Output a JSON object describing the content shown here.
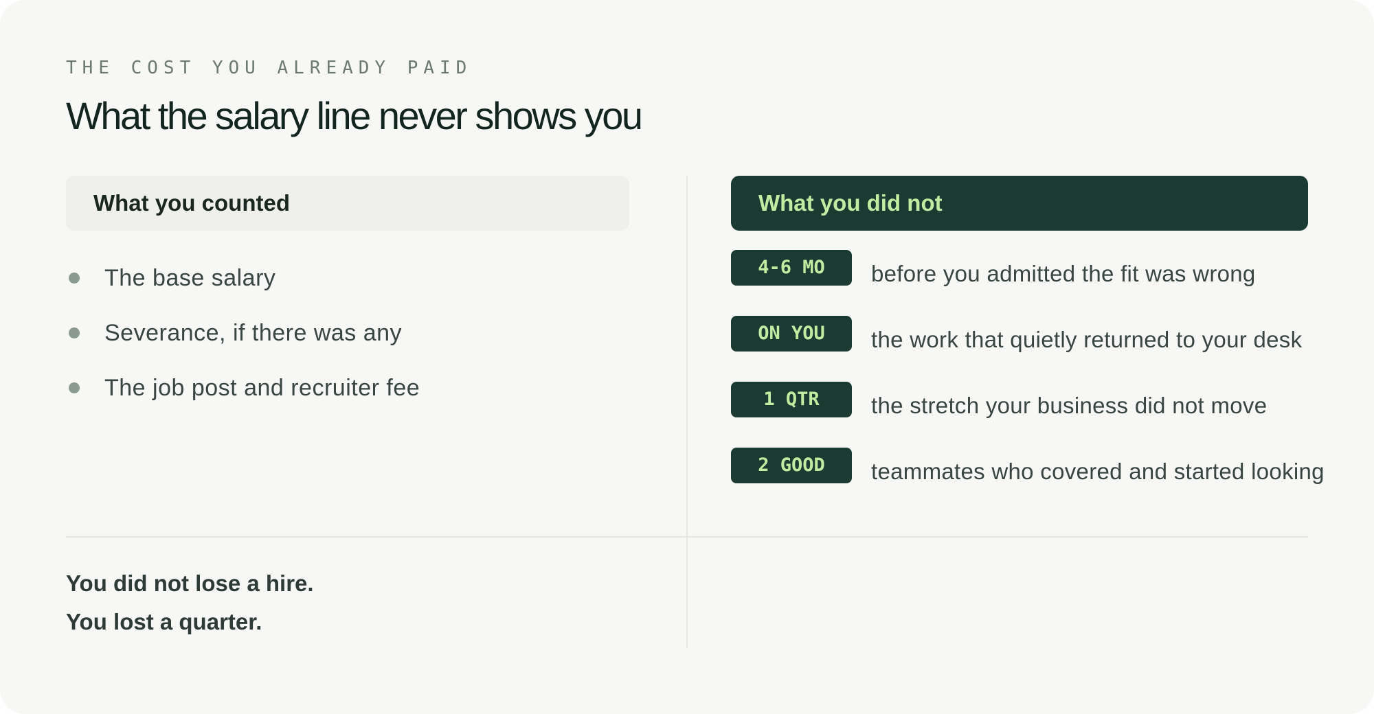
{
  "header": {
    "eyebrow": "THE COST YOU ALREADY PAID",
    "title": "What the salary line never shows you"
  },
  "left_column": {
    "heading": "What you counted",
    "items": [
      "The base salary",
      "Severance, if there was any",
      "The job post and recruiter fee"
    ]
  },
  "right_column": {
    "heading": "What you did not",
    "items": [
      {
        "tag": "4-6 MO",
        "text": "before you admitted the fit was wrong"
      },
      {
        "tag": "ON YOU",
        "text": "the work that quietly returned to your desk"
      },
      {
        "tag": "1 QTR",
        "text": "the stretch your business did not move"
      },
      {
        "tag": "2 GOOD",
        "text": "teammates who covered and started looking"
      }
    ]
  },
  "closing": {
    "line1": "You did not lose a hire.",
    "line2": "You lost a quarter."
  },
  "colors": {
    "background": "#f7f7f6",
    "accent_dark": "#1b3b32",
    "accent_light": "#c3eba1",
    "bullet": "#8a9a93"
  }
}
